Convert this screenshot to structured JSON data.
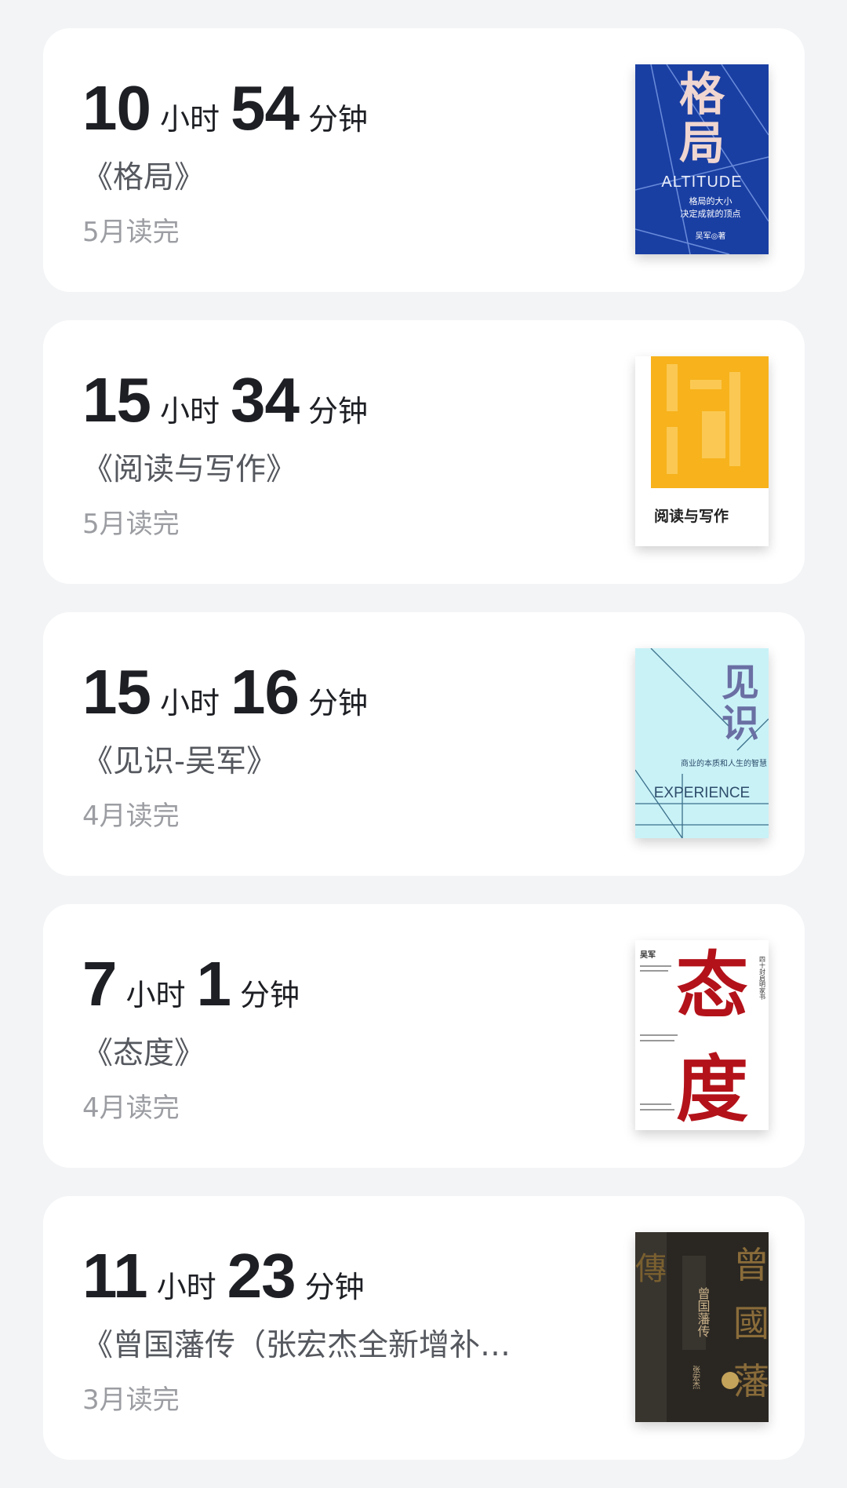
{
  "books": [
    {
      "hours": "10",
      "hours_unit": "小时",
      "minutes": "54",
      "minutes_unit": "分钟",
      "title": "《格局》",
      "finished": "5月读完",
      "cover": {
        "main": "格局",
        "top": "格",
        "bottom": "局",
        "subtitle": "ALTITUDE",
        "line1": "格局的大小",
        "line2": "决定成就的顶点",
        "author": "吴军◎著",
        "color": "#1a3fa3"
      }
    },
    {
      "hours": "15",
      "hours_unit": "小时",
      "minutes": "34",
      "minutes_unit": "分钟",
      "title": "《阅读与写作》",
      "finished": "5月读完",
      "cover": {
        "label": "阅读与写作",
        "color": "#f7b21c"
      }
    },
    {
      "hours": "15",
      "hours_unit": "小时",
      "minutes": "16",
      "minutes_unit": "分钟",
      "title": "《见识-吴军》",
      "finished": "4月读完",
      "cover": {
        "top": "见",
        "bottom": "识",
        "tag": "商业的本质和人生的智慧",
        "subtitle": "EXPERIENCE",
        "color": "#c9f2f7"
      }
    },
    {
      "hours": "7",
      "hours_unit": "小时",
      "minutes": "1",
      "minutes_unit": "分钟",
      "title": "《态度》",
      "finished": "4月读完",
      "cover": {
        "top": "态",
        "bottom": "度",
        "author": "吴军",
        "side": "四十封启明家书",
        "color": "#b3121a"
      }
    },
    {
      "hours": "11",
      "hours_unit": "小时",
      "minutes": "23",
      "minutes_unit": "分钟",
      "title": "《曾国藩传（张宏杰全新增补版...",
      "finished": "3月读完",
      "cover": {
        "vertical": "曾国藩传",
        "big1": "曾",
        "big2": "國",
        "big3": "藩",
        "author": "张宏杰",
        "color": "#2a2722"
      }
    }
  ]
}
